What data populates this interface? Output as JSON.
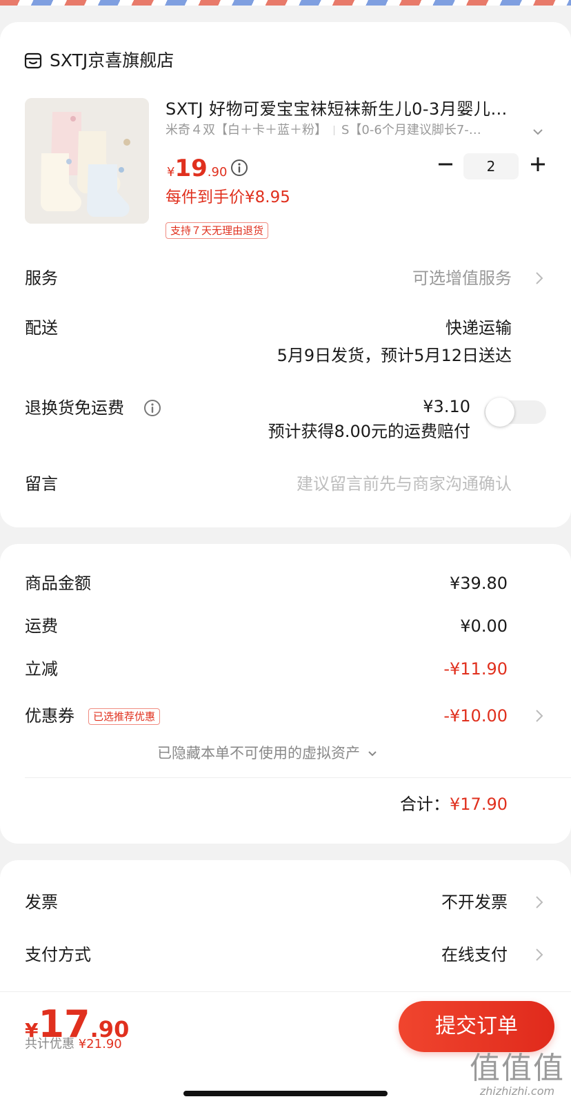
{
  "store": {
    "name": "SXTJ京喜旗舰店"
  },
  "product": {
    "title": "SXTJ 好物可爱宝宝袜短袜新生儿0-3月婴儿…",
    "sku_color": "米奇４双【白＋卡＋蓝＋粉】",
    "sku_size": "S【0-6个月建议脚长7-…",
    "price_symbol": "¥",
    "price_int": "19",
    "price_dec": ".90",
    "per_item_price": "每件到手价¥8.95",
    "return_badge": "支持７天无理由退货",
    "quantity": "2"
  },
  "rows": {
    "service": {
      "label": "服务",
      "value": "可选增值服务"
    },
    "delivery": {
      "label": "配送",
      "method": "快递运输",
      "eta": "5月9日发货，预计5月12日送达"
    },
    "return_shipping": {
      "label": "退换货免运费",
      "price": "¥3.10",
      "note": "预计获得8.00元的运费赔付",
      "enabled": false
    },
    "message": {
      "label": "留言",
      "placeholder": "建议留言前先与商家沟通确认"
    }
  },
  "summary": {
    "goods_label": "商品金额",
    "goods_value": "¥39.80",
    "shipping_label": "运费",
    "shipping_value": "¥0.00",
    "discount_label": "立减",
    "discount_value": "-¥11.90",
    "coupon_label": "优惠券",
    "coupon_badge": "已选推荐优惠",
    "coupon_value": "-¥10.00",
    "hidden_assets": "已隐藏本单不可使用的虚拟资产",
    "total_label": "合计：",
    "total_value": "¥17.90"
  },
  "invoice": {
    "label": "发票",
    "value": "不开发票"
  },
  "payment": {
    "label": "支付方式",
    "value": "在线支付"
  },
  "footer": {
    "price_symbol": "¥",
    "price_int": "17",
    "price_dec": ".90",
    "saving_label": "共计优惠",
    "saving_value": "¥21.90",
    "submit_label": "提交订单"
  },
  "watermark": {
    "glyph": "值值值",
    "text": "zhizhizhi.com"
  },
  "colors": {
    "accent": "#e0301e",
    "background": "#f2f2f2"
  }
}
